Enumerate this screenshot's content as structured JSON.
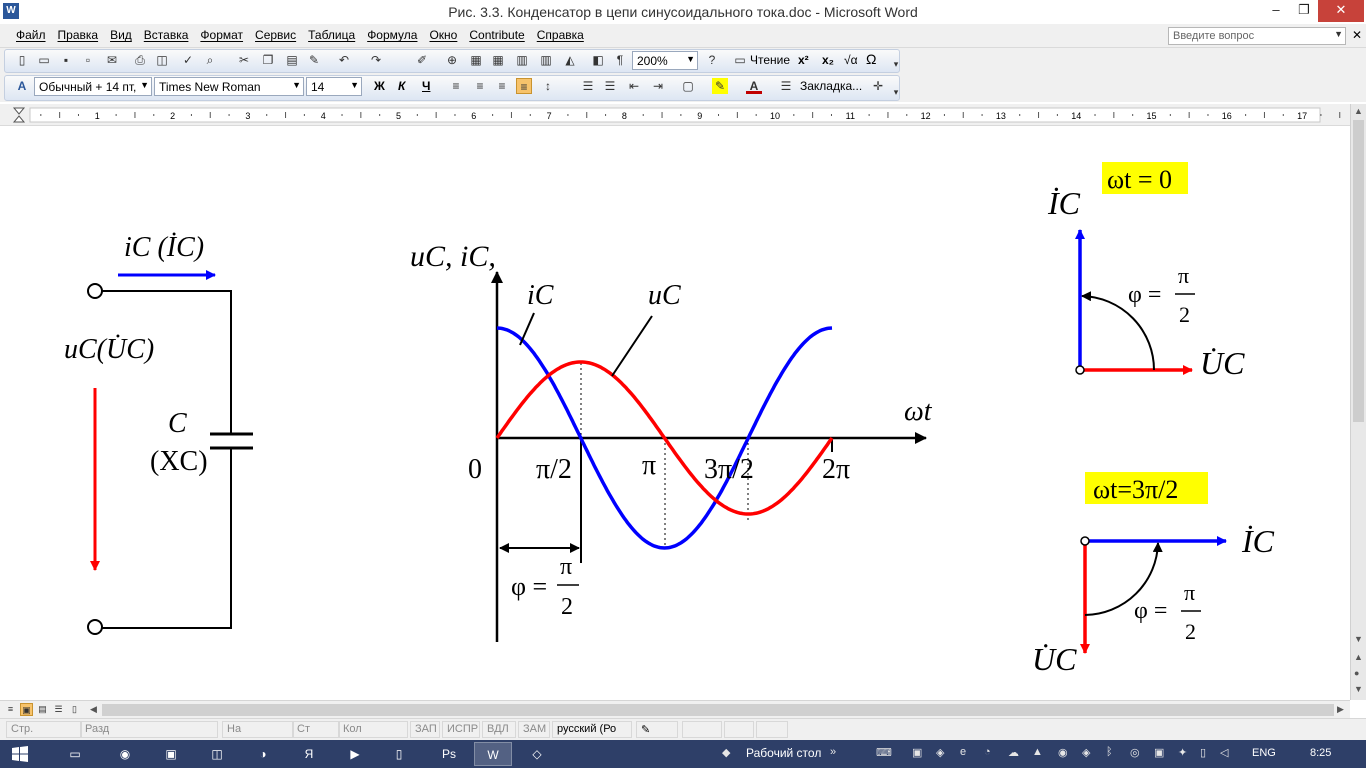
{
  "window": {
    "title": "Рис. 3.3. Конденсатор  в цепи синусоидального тока.doc - Microsoft Word",
    "app_icon_letter": "W",
    "buttons": {
      "minimize": "–",
      "maximize": "❐",
      "close": "✕"
    }
  },
  "menu": {
    "items": [
      "Файл",
      "Правка",
      "Вид",
      "Вставка",
      "Формат",
      "Сервис",
      "Таблица",
      "Формула",
      "Окно",
      "Contribute",
      "Справка"
    ],
    "ask_placeholder": "Введите вопрос",
    "close_doc": "✕"
  },
  "standard_toolbar": {
    "zoom": "200%",
    "reading_label": "Чтение",
    "superscript": "x²",
    "subscript": "x₂",
    "omega": "Ω",
    "sqrt": "√α"
  },
  "formatting_toolbar": {
    "style": "Обычный + 14 пт,",
    "font": "Times New Roman",
    "size": "14",
    "bold": "Ж",
    "italic": "К",
    "underline": "Ч",
    "bookmark": "Закладка..."
  },
  "ruler": {
    "numbers": [
      "1",
      "2",
      "3",
      "4",
      "5",
      "6",
      "7",
      "8",
      "9",
      "10",
      "11",
      "12",
      "13",
      "14",
      "15",
      "16",
      "17"
    ]
  },
  "figure": {
    "circuit": {
      "current_label": "iC (İC)",
      "voltage_label": "uC(U̇C)",
      "capacitor_label": "C",
      "reactance_label": "(XC)"
    },
    "graph": {
      "y_axis_label": "uC, iC,",
      "x_axis_label": "ωt",
      "origin_label": "0",
      "tick_labels": [
        "π/2",
        "π",
        "3π/2",
        "2π"
      ],
      "curve_labels": [
        "iC",
        "uC"
      ],
      "phase_label": "φ =",
      "phase_num": "π",
      "phase_den": "2"
    },
    "phasor_top": {
      "label": "ωt = 0",
      "current": "İC",
      "voltage": "U̇C",
      "phase_label": "φ =",
      "phase_num": "π",
      "phase_den": "2"
    },
    "phasor_bottom": {
      "label": "ωt=3π/2",
      "current": "İC",
      "voltage": "U̇C",
      "phase_label": "φ =",
      "phase_num": "π",
      "phase_den": "2"
    },
    "colors": {
      "current": "#0000ff",
      "voltage": "#ff0000",
      "highlight": "#ffff00"
    }
  },
  "statusbar": {
    "page": "Стр.",
    "section": "Разд",
    "at": "На",
    "line": "Ст",
    "col": "Кол",
    "rec": "ЗАП",
    "trk": "ИСПР",
    "ext": "ВДЛ",
    "ovr": "ЗАМ",
    "language": "русский (Ро"
  },
  "taskbar": {
    "desktop_label": "Рабочий стол",
    "lang": "ENG",
    "time": "8:25"
  }
}
